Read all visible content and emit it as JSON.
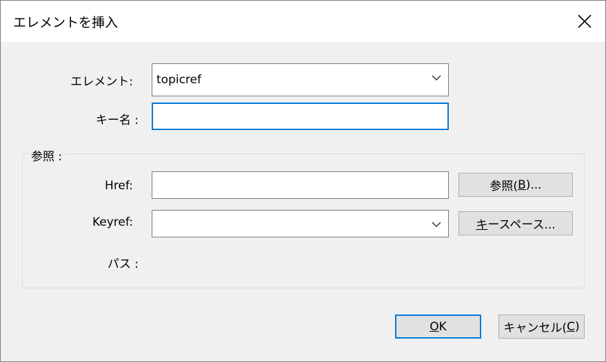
{
  "dialog": {
    "title": "エレメントを挿入"
  },
  "form": {
    "element_label": "エレメント:",
    "element_value": "topicref",
    "key_name_label": "キー名 :",
    "key_name_value": ""
  },
  "reference_group": {
    "caption": "参照 :",
    "href_label": "Href:",
    "href_value": "",
    "browse_button": {
      "before": "参照(",
      "mnemonic": "B",
      "after": ")..."
    },
    "keyref_label": "Keyref:",
    "keyref_value": "",
    "keyspace_button": {
      "mnemonic": "キ",
      "after": "ースペース..."
    },
    "path_label": "パス :"
  },
  "buttons": {
    "ok": {
      "mnemonic": "O",
      "after": "K"
    },
    "cancel": {
      "before": "キャンセル(",
      "mnemonic": "C",
      "after": ")"
    }
  },
  "colors": {
    "focus": "#0078d7",
    "dialog_bg": "#f0f0f0",
    "title_bg": "#ffffff"
  },
  "icons": {
    "close": "close-icon",
    "dropdown": "chevron-down-icon"
  }
}
